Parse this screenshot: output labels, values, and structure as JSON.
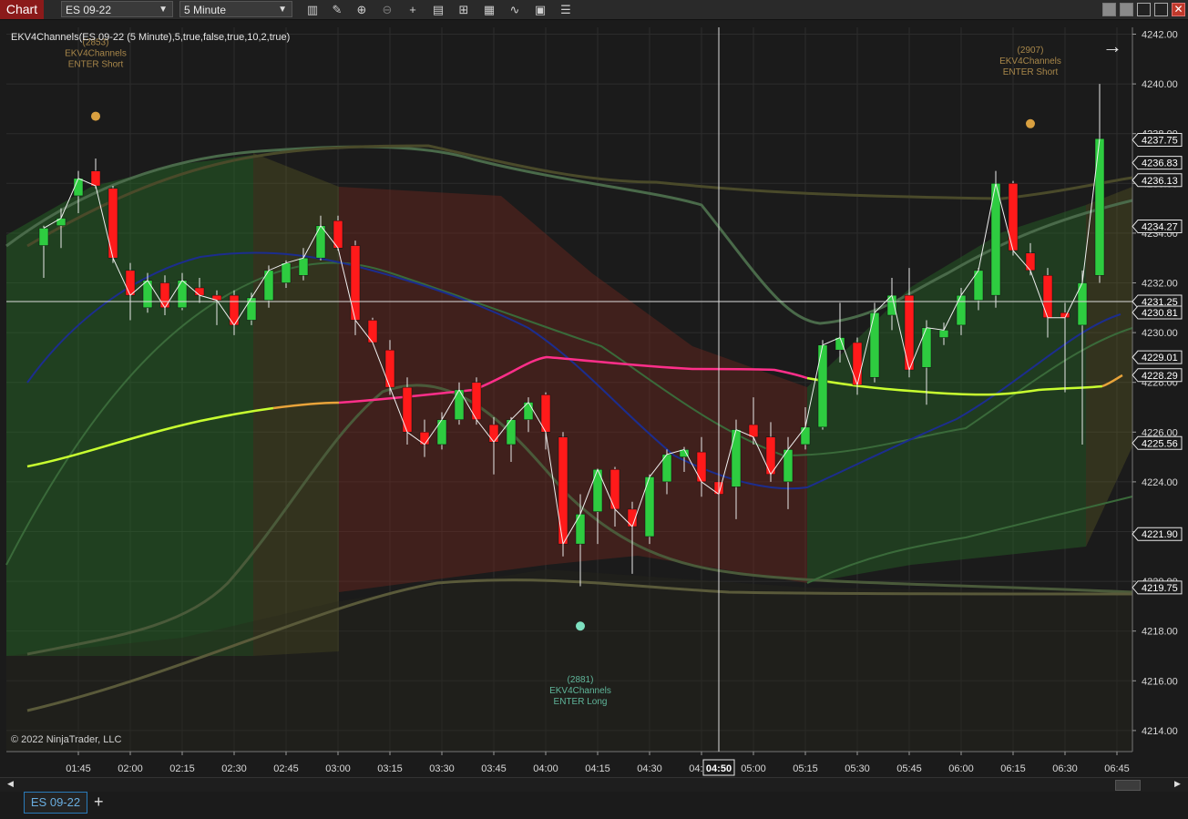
{
  "toolbar": {
    "chart_label": "Chart",
    "instrument": "ES 09-22",
    "interval": "5 Minute",
    "tools": [
      "bars-icon",
      "pencil-icon",
      "zoom-in-icon",
      "zoom-out-icon",
      "crosshair-icon",
      "properties-icon",
      "templates-icon",
      "strategies-icon",
      "indicators-icon",
      "data-box-icon",
      "list-icon"
    ]
  },
  "indicator_title": "EKV4Channels(ES 09-22 (5 Minute),5,true,false,true,10,2,true)",
  "copyright": "© 2022 NinjaTrader, LLC",
  "signals": [
    {
      "id": "(2853)",
      "name": "EKV4Channels",
      "action": "ENTER Short",
      "time": "01:50",
      "price": 4238.7,
      "color": "#d9a040"
    },
    {
      "id": "(2907)",
      "name": "EKV4Channels",
      "action": "ENTER Short",
      "time": "06:20",
      "price": 4238.4,
      "color": "#d9a040"
    },
    {
      "id": "(2881)",
      "name": "EKV4Channels",
      "action": "ENTER Long",
      "time": "04:10",
      "price": 4218.2,
      "color": "#7de0c0"
    }
  ],
  "chart_data": {
    "type": "candlestick",
    "instrument": "ES 09-22",
    "interval": "5 Minute",
    "x_ticks": [
      "01:45",
      "02:00",
      "02:15",
      "02:30",
      "02:45",
      "03:00",
      "03:15",
      "03:30",
      "03:45",
      "04:00",
      "04:15",
      "04:30",
      "04:45",
      "05:00",
      "05:15",
      "05:30",
      "05:45",
      "06:00",
      "06:15",
      "06:30",
      "06:45"
    ],
    "y_ticks": [
      4242.0,
      4240.0,
      4238.0,
      4236.0,
      4234.0,
      4232.0,
      4230.0,
      4228.0,
      4226.0,
      4224.0,
      4222.0,
      4220.0,
      4218.0,
      4216.0,
      4214.0
    ],
    "ylim": [
      4213.6,
      4242.3
    ],
    "crosshair": {
      "time": "04:50",
      "price": "4231.25"
    },
    "price_markers": [
      {
        "label": "4237.75",
        "value": 4237.75
      },
      {
        "label": "4236.83",
        "value": 4236.83
      },
      {
        "label": "4236.13",
        "value": 4236.13
      },
      {
        "label": "4234.27",
        "value": 4234.27
      },
      {
        "label": "4231.25",
        "value": 4231.25
      },
      {
        "label": "4230.81",
        "value": 4230.81
      },
      {
        "label": "4229.01",
        "value": 4229.01
      },
      {
        "label": "4228.29",
        "value": 4228.29
      },
      {
        "label": "4225.56",
        "value": 4225.56
      },
      {
        "label": "4221.90",
        "value": 4221.9
      },
      {
        "label": "4219.75",
        "value": 4219.75
      }
    ],
    "candles": [
      {
        "t": "01:35",
        "o": 4233.5,
        "h": 4234.3,
        "l": 4232.2,
        "c": 4234.2
      },
      {
        "t": "01:40",
        "o": 4234.3,
        "h": 4235.0,
        "l": 4233.4,
        "c": 4234.6
      },
      {
        "t": "01:45",
        "o": 4235.5,
        "h": 4236.5,
        "l": 4234.8,
        "c": 4236.2
      },
      {
        "t": "01:50",
        "o": 4236.5,
        "h": 4237.0,
        "l": 4235.8,
        "c": 4235.9
      },
      {
        "t": "01:55",
        "o": 4235.8,
        "h": 4235.9,
        "l": 4232.8,
        "c": 4233.0
      },
      {
        "t": "02:00",
        "o": 4232.5,
        "h": 4232.8,
        "l": 4230.5,
        "c": 4231.5
      },
      {
        "t": "02:05",
        "o": 4231.0,
        "h": 4232.4,
        "l": 4230.8,
        "c": 4232.1
      },
      {
        "t": "02:10",
        "o": 4232.0,
        "h": 4232.3,
        "l": 4230.7,
        "c": 4231.0
      },
      {
        "t": "02:15",
        "o": 4231.0,
        "h": 4232.4,
        "l": 4230.9,
        "c": 4232.1
      },
      {
        "t": "02:20",
        "o": 4231.8,
        "h": 4232.2,
        "l": 4231.2,
        "c": 4231.5
      },
      {
        "t": "02:25",
        "o": 4231.5,
        "h": 4231.7,
        "l": 4230.3,
        "c": 4231.3
      },
      {
        "t": "02:30",
        "o": 4231.5,
        "h": 4231.7,
        "l": 4229.9,
        "c": 4230.3
      },
      {
        "t": "02:35",
        "o": 4230.5,
        "h": 4231.6,
        "l": 4230.3,
        "c": 4231.4
      },
      {
        "t": "02:40",
        "o": 4231.3,
        "h": 4232.7,
        "l": 4231.0,
        "c": 4232.5
      },
      {
        "t": "02:45",
        "o": 4232.0,
        "h": 4232.9,
        "l": 4231.8,
        "c": 4232.8
      },
      {
        "t": "02:50",
        "o": 4232.3,
        "h": 4233.4,
        "l": 4232.1,
        "c": 4233.0
      },
      {
        "t": "02:55",
        "o": 4233.0,
        "h": 4234.7,
        "l": 4232.9,
        "c": 4234.3
      },
      {
        "t": "03:00",
        "o": 4234.5,
        "h": 4234.7,
        "l": 4233.3,
        "c": 4233.4
      },
      {
        "t": "03:05",
        "o": 4233.5,
        "h": 4233.7,
        "l": 4229.9,
        "c": 4230.5
      },
      {
        "t": "03:10",
        "o": 4230.5,
        "h": 4230.6,
        "l": 4229.7,
        "c": 4229.6
      },
      {
        "t": "03:15",
        "o": 4229.3,
        "h": 4229.7,
        "l": 4227.5,
        "c": 4227.8
      },
      {
        "t": "03:20",
        "o": 4227.8,
        "h": 4228.2,
        "l": 4225.5,
        "c": 4226.0
      },
      {
        "t": "03:25",
        "o": 4226.0,
        "h": 4226.5,
        "l": 4225.0,
        "c": 4225.5
      },
      {
        "t": "03:30",
        "o": 4225.5,
        "h": 4226.8,
        "l": 4225.3,
        "c": 4226.5
      },
      {
        "t": "03:35",
        "o": 4226.5,
        "h": 4228.0,
        "l": 4226.3,
        "c": 4227.7
      },
      {
        "t": "03:40",
        "o": 4228.0,
        "h": 4228.2,
        "l": 4226.3,
        "c": 4226.5
      },
      {
        "t": "03:45",
        "o": 4226.3,
        "h": 4226.6,
        "l": 4224.3,
        "c": 4225.6
      },
      {
        "t": "03:50",
        "o": 4225.5,
        "h": 4226.6,
        "l": 4224.8,
        "c": 4226.5
      },
      {
        "t": "03:55",
        "o": 4226.5,
        "h": 4227.4,
        "l": 4226.0,
        "c": 4227.2
      },
      {
        "t": "04:00",
        "o": 4227.5,
        "h": 4227.6,
        "l": 4225.3,
        "c": 4226.0
      },
      {
        "t": "04:05",
        "o": 4225.8,
        "h": 4226.0,
        "l": 4221.0,
        "c": 4221.5
      },
      {
        "t": "04:10",
        "o": 4221.5,
        "h": 4223.5,
        "l": 4219.8,
        "c": 4222.7
      },
      {
        "t": "04:15",
        "o": 4222.8,
        "h": 4224.5,
        "l": 4221.5,
        "c": 4224.5
      },
      {
        "t": "04:20",
        "o": 4224.5,
        "h": 4224.6,
        "l": 4222.2,
        "c": 4222.9
      },
      {
        "t": "04:25",
        "o": 4222.9,
        "h": 4223.2,
        "l": 4220.3,
        "c": 4222.2
      },
      {
        "t": "04:30",
        "o": 4221.8,
        "h": 4224.3,
        "l": 4221.5,
        "c": 4224.2
      },
      {
        "t": "04:35",
        "o": 4224.0,
        "h": 4225.3,
        "l": 4223.5,
        "c": 4225.1
      },
      {
        "t": "04:40",
        "o": 4225.0,
        "h": 4225.4,
        "l": 4224.4,
        "c": 4225.3
      },
      {
        "t": "04:45",
        "o": 4225.2,
        "h": 4225.8,
        "l": 4223.4,
        "c": 4224.0
      },
      {
        "t": "04:50",
        "o": 4224.0,
        "h": 4224.6,
        "l": 4223.0,
        "c": 4223.5
      },
      {
        "t": "04:55",
        "o": 4223.8,
        "h": 4226.5,
        "l": 4222.5,
        "c": 4226.1
      },
      {
        "t": "05:00",
        "o": 4226.3,
        "h": 4227.4,
        "l": 4225.5,
        "c": 4225.8
      },
      {
        "t": "05:05",
        "o": 4225.8,
        "h": 4226.4,
        "l": 4224.0,
        "c": 4224.3
      },
      {
        "t": "05:10",
        "o": 4224.0,
        "h": 4225.8,
        "l": 4222.9,
        "c": 4225.3
      },
      {
        "t": "05:15",
        "o": 4225.5,
        "h": 4227.0,
        "l": 4225.3,
        "c": 4226.2
      },
      {
        "t": "05:20",
        "o": 4226.2,
        "h": 4229.7,
        "l": 4226.1,
        "c": 4229.5
      },
      {
        "t": "05:25",
        "o": 4229.3,
        "h": 4231.2,
        "l": 4228.8,
        "c": 4229.8
      },
      {
        "t": "05:30",
        "o": 4229.6,
        "h": 4229.8,
        "l": 4227.5,
        "c": 4227.9
      },
      {
        "t": "05:35",
        "o": 4228.2,
        "h": 4231.2,
        "l": 4228.0,
        "c": 4230.8
      },
      {
        "t": "05:40",
        "o": 4230.7,
        "h": 4232.2,
        "l": 4230.1,
        "c": 4231.5
      },
      {
        "t": "05:45",
        "o": 4231.5,
        "h": 4232.6,
        "l": 4228.2,
        "c": 4228.5
      },
      {
        "t": "05:50",
        "o": 4228.6,
        "h": 4230.5,
        "l": 4227.1,
        "c": 4230.2
      },
      {
        "t": "05:55",
        "o": 4229.8,
        "h": 4230.4,
        "l": 4229.5,
        "c": 4230.1
      },
      {
        "t": "06:00",
        "o": 4230.3,
        "h": 4231.8,
        "l": 4229.9,
        "c": 4231.5
      },
      {
        "t": "06:05",
        "o": 4231.3,
        "h": 4232.6,
        "l": 4230.9,
        "c": 4232.5
      },
      {
        "t": "06:10",
        "o": 4231.5,
        "h": 4236.5,
        "l": 4231.0,
        "c": 4236.0
      },
      {
        "t": "06:15",
        "o": 4236.0,
        "h": 4236.1,
        "l": 4233.1,
        "c": 4233.3
      },
      {
        "t": "06:20",
        "o": 4233.2,
        "h": 4233.6,
        "l": 4232.3,
        "c": 4232.5
      },
      {
        "t": "06:25",
        "o": 4232.3,
        "h": 4232.6,
        "l": 4229.8,
        "c": 4230.6
      },
      {
        "t": "06:30",
        "o": 4230.8,
        "h": 4231.2,
        "l": 4227.6,
        "c": 4230.6
      },
      {
        "t": "06:35",
        "o": 4230.3,
        "h": 4232.5,
        "l": 4225.5,
        "c": 4232.0
      },
      {
        "t": "06:40",
        "o": 4232.3,
        "h": 4240.0,
        "l": 4232.0,
        "c": 4237.8
      }
    ]
  },
  "colors": {
    "background": "#1b1b1b",
    "grid": "#2c2c2c",
    "up": "#2ecc40",
    "down": "#ff1a1a",
    "midline_bull": "#c8ff30",
    "midline_bear": "#ff2f8a",
    "midline_neutral": "#e8a33a",
    "slow_ma": "#1a2a8a",
    "crosshair": "#dcdcdc"
  },
  "bottom_tab": "ES 09-22"
}
